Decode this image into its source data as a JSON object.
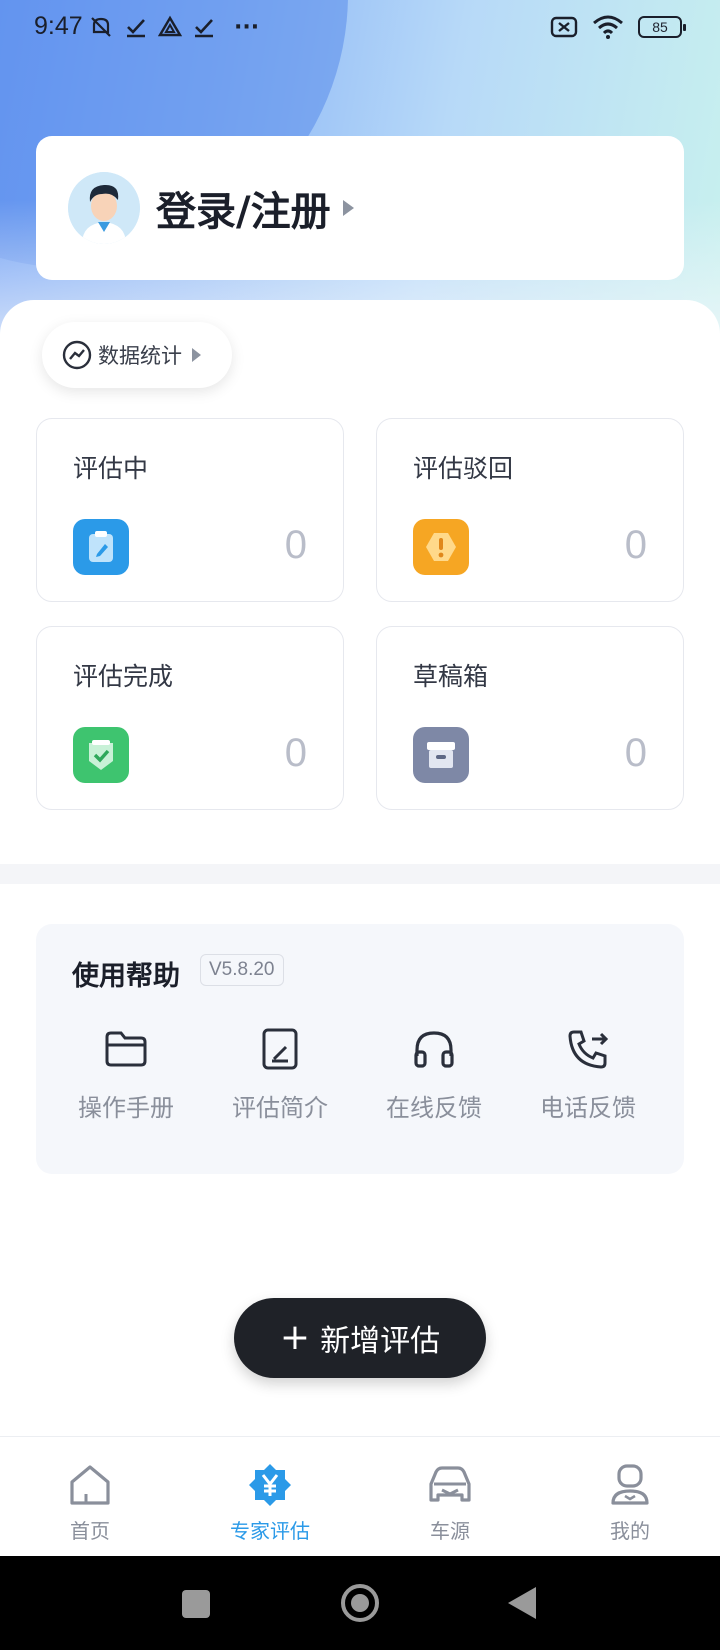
{
  "status_bar": {
    "time": "9:47",
    "battery": "85",
    "more": "···"
  },
  "login": {
    "label": "登录/注册"
  },
  "stats": {
    "label": "数据统计"
  },
  "cards": [
    {
      "title": "评估中",
      "count": "0",
      "icon": "clipboard-edit-icon",
      "color": "#2b9ae8"
    },
    {
      "title": "评估驳回",
      "count": "0",
      "icon": "warning-badge-icon",
      "color": "#f6a623"
    },
    {
      "title": "评估完成",
      "count": "0",
      "icon": "check-badge-icon",
      "color": "#3ec46f"
    },
    {
      "title": "草稿箱",
      "count": "0",
      "icon": "archive-box-icon",
      "color": "#7e88a6"
    }
  ],
  "help": {
    "title": "使用帮助",
    "version": "V5.8.20",
    "items": [
      {
        "label": "操作手册",
        "icon": "folder-icon"
      },
      {
        "label": "评估简介",
        "icon": "document-edit-icon"
      },
      {
        "label": "在线反馈",
        "icon": "headset-icon"
      },
      {
        "label": "电话反馈",
        "icon": "phone-forward-icon"
      }
    ]
  },
  "add_button": {
    "label": "新增评估"
  },
  "tabs": [
    {
      "label": "首页",
      "icon": "home-icon",
      "active": false
    },
    {
      "label": "专家评估",
      "icon": "yuan-badge-icon",
      "active": true
    },
    {
      "label": "车源",
      "icon": "car-icon",
      "active": false
    },
    {
      "label": "我的",
      "icon": "user-icon",
      "active": false
    }
  ],
  "colors": {
    "accent": "#2b9ae8",
    "dark_button": "#1f2228"
  }
}
